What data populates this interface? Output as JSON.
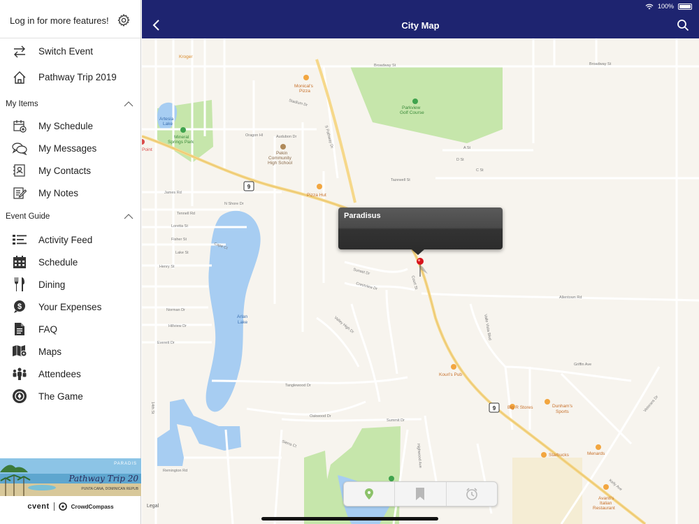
{
  "sidebar": {
    "login_text": "Log in for more features!",
    "top_items": [
      {
        "label": "Switch Event",
        "icon": "switch-arrows-icon"
      },
      {
        "label": "Pathway Trip 2019",
        "icon": "home-icon"
      }
    ],
    "sections": [
      {
        "title": "My Items",
        "items": [
          {
            "label": "My Schedule",
            "icon": "calendar-add-icon"
          },
          {
            "label": "My Messages",
            "icon": "chat-bubbles-icon"
          },
          {
            "label": "My Contacts",
            "icon": "contact-card-icon"
          },
          {
            "label": "My Notes",
            "icon": "note-pencil-icon"
          }
        ]
      },
      {
        "title": "Event Guide",
        "items": [
          {
            "label": "Activity Feed",
            "icon": "list-icon"
          },
          {
            "label": "Schedule",
            "icon": "calendar-icon"
          },
          {
            "label": "Dining",
            "icon": "fork-knife-icon"
          },
          {
            "label": "Your Expenses",
            "icon": "dollar-icon"
          },
          {
            "label": "FAQ",
            "icon": "document-icon"
          },
          {
            "label": "Maps",
            "icon": "map-icon"
          },
          {
            "label": "Attendees",
            "icon": "people-icon"
          },
          {
            "label": "The Game",
            "icon": "game-icon"
          }
        ]
      }
    ],
    "banner": {
      "brand": "PARADIS",
      "title": "Pathway Trip 20",
      "subtitle": "PUNTA CANA, DOMINICAN REPUB"
    },
    "footer": {
      "cvent": "cvent",
      "crowdcompass": "CrowdCompass"
    }
  },
  "header": {
    "title": "City Map",
    "battery": "100%"
  },
  "map": {
    "callout": "Paradisus",
    "legal": "Legal",
    "streets": [
      "Broadway St",
      "Stadium Dr",
      "Oragon Hl",
      "Audubon Dr",
      "S Pathway Dr",
      "Tazewell St",
      "James Rd",
      "N Shore Dr",
      "Tennell Rd",
      "Loretta St",
      "Fisher St",
      "Lake St",
      "Henry St",
      "Cape Ct",
      "Sunset Dr",
      "Crestview Dr",
      "Court St",
      "Allentown Rd",
      "Norman Dr",
      "Hillview Dr",
      "Everett Dr",
      "Valle Vista Blvd",
      "Griffin Ave",
      "Tanglewood Dr",
      "Oakwood Dr",
      "Summit Dr",
      "Remington Rd",
      "Veterans Dr",
      "Sierra Ct",
      "Kelly Ave",
      "A St",
      "C St",
      "D St",
      "14th St",
      "Valley High Dr",
      "Highwood Ave"
    ],
    "pois": [
      "Kroger",
      "Monical's Pizza",
      "Parkview Golf Course",
      "Artesia Lake",
      "Mineral Springs Park",
      "Pekin Community High School",
      "Pizza Hut",
      "Arlan Lake",
      "Kouri's Pub",
      "Big R Stores",
      "Dunham's Sports",
      "Starbucks",
      "Menards",
      "Avanti's Italian Restaurant",
      "Point"
    ],
    "route_shields": [
      "9",
      "9"
    ]
  },
  "toolbar": {
    "items": [
      {
        "icon": "location-pin-icon"
      },
      {
        "icon": "bookmark-icon"
      },
      {
        "icon": "clock-icon"
      }
    ]
  },
  "colors": {
    "header_bg": "#1e2470",
    "water": "#a7cdf2",
    "park": "#c4e5a8",
    "road_major": "#f6d88a",
    "pin": "#d7141c"
  }
}
